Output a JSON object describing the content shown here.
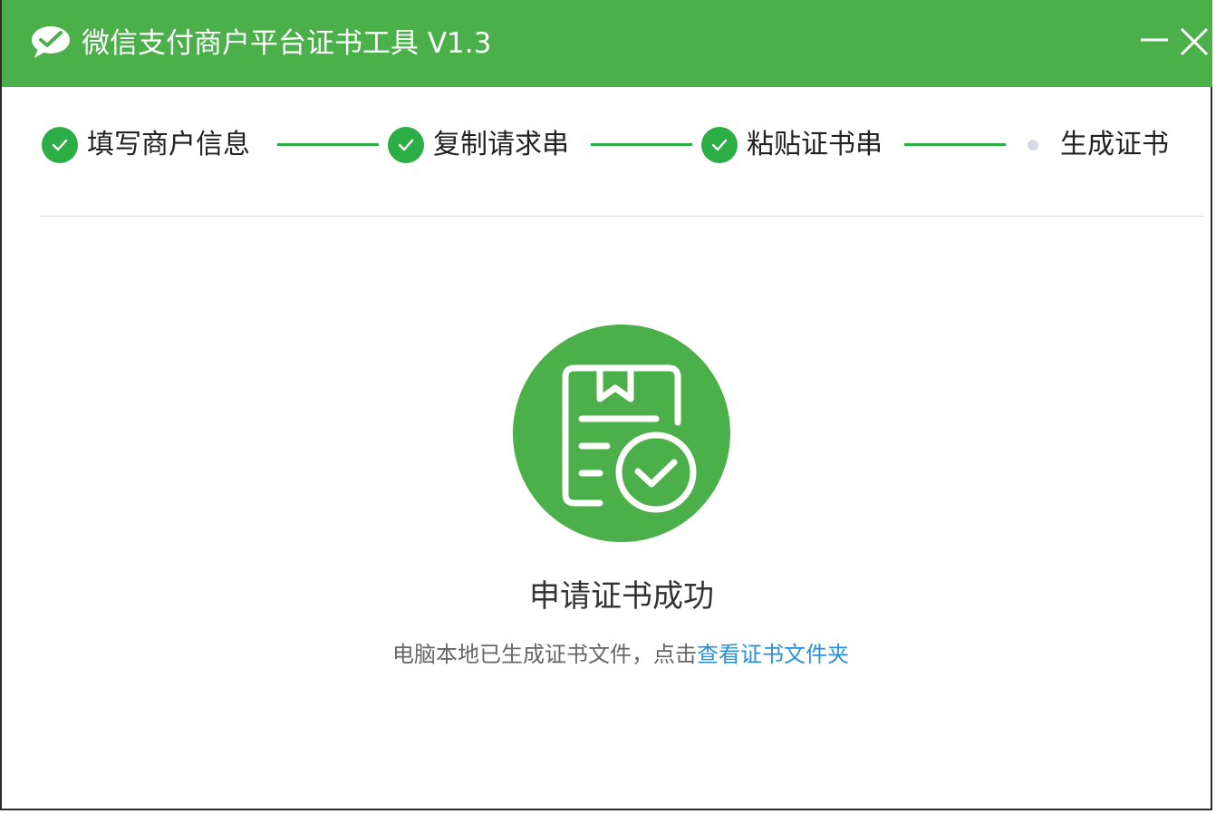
{
  "window": {
    "title": "微信支付商户平台证书工具 V1.3",
    "controls": {
      "minimize_icon": "minimize-icon",
      "close_icon": "close-icon"
    }
  },
  "steps": [
    {
      "label": "填写商户信息",
      "state": "done",
      "icon": "check-circle-icon"
    },
    {
      "label": "复制请求串",
      "state": "done",
      "icon": "check-circle-icon"
    },
    {
      "label": "粘贴证书串",
      "state": "done",
      "icon": "check-circle-icon"
    },
    {
      "label": "生成证书",
      "state": "current",
      "icon": "dot-icon"
    }
  ],
  "result": {
    "icon": "certificate-success-icon",
    "title": "申请证书成功",
    "description_prefix": "电脑本地已生成证书文件，点击",
    "link_label": "查看证书文件夹"
  },
  "colors": {
    "titlebar": "#4bb04a",
    "step_done": "#2aae45",
    "step_pending": "#d3d9e3",
    "link": "#2a8fd6"
  }
}
